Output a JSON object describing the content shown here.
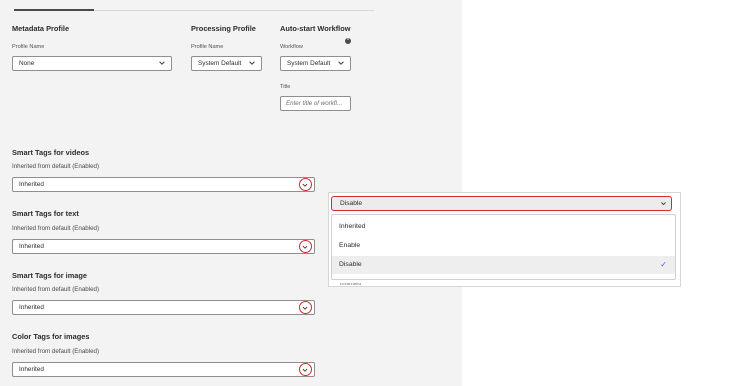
{
  "metadata": {
    "heading": "Metadata Profile",
    "field_label": "Profile Name",
    "value": "None"
  },
  "processing": {
    "heading": "Processing Profile",
    "field_label": "Profile Name",
    "value": "System Default"
  },
  "workflow": {
    "heading": "Auto-start Workflow",
    "field_label": "Workflow",
    "value": "System Default",
    "title_label": "Title",
    "title_placeholder": "Enter title of workfl..."
  },
  "smart_tags": [
    {
      "heading": "Smart Tags for videos",
      "inherited_note": "Inherited from default (Enabled)",
      "value": "Inherited"
    },
    {
      "heading": "Smart Tags for text",
      "inherited_note": "Inherited from default (Enabled)",
      "value": "Inherited"
    },
    {
      "heading": "Smart Tags for image",
      "inherited_note": "Inherited from default (Enabled)",
      "value": "Inherited"
    },
    {
      "heading": "Color Tags for images",
      "inherited_note": "Inherited from default (Enabled)",
      "value": "Inherited"
    }
  ],
  "dropdown": {
    "selected_value": "Disable",
    "options": [
      "Inherited",
      "Enable",
      "Disable"
    ],
    "selected_index": 2,
    "underlying_value": "Inherited"
  },
  "colors": {
    "highlight_red": "#d7262d",
    "check_blue": "#2f6fd1",
    "panel_bg": "#f3f3f3"
  },
  "icons": {
    "chevron": "chevron-down-icon",
    "info": "info-icon",
    "check": "checkmark-icon"
  }
}
